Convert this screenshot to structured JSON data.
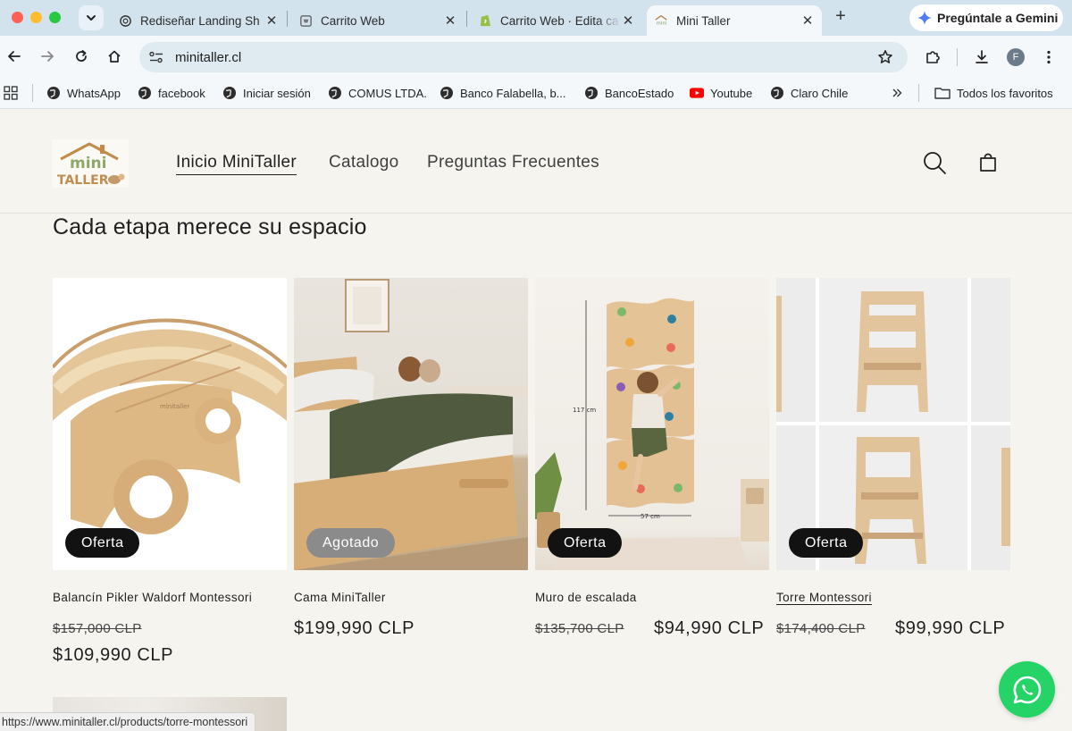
{
  "browser": {
    "tabs": [
      {
        "title": "Rediseñar Landing Sh",
        "favicon": "openai-icon"
      },
      {
        "title": "Carrito Web",
        "favicon": "cart-page-icon"
      },
      {
        "title": "Carrito Web · Edita ca",
        "favicon": "shopify-icon"
      },
      {
        "title": "Mini Taller",
        "favicon": "minitaller-icon"
      }
    ],
    "gemini_label": "Pregúntale a Gemini",
    "url": "minitaller.cl",
    "profile_initial": "F",
    "bookmarks": [
      "WhatsApp",
      "facebook",
      "Iniciar sesión",
      "COMUS LTDA.",
      "Banco Falabella, b...",
      "BancoEstado",
      "Youtube",
      "Claro Chile"
    ],
    "all_bookmarks": "Todos los favoritos",
    "status_url": "https://www.minitaller.cl/products/torre-montessori"
  },
  "site": {
    "logo_text_top": "mini",
    "logo_text_bottom": "TALLER",
    "nav": [
      "Inicio MiniTaller",
      "Catalogo",
      "Preguntas Frecuentes"
    ],
    "section_title": "Cada etapa merece su espacio",
    "products": [
      {
        "name": "Balancín Pikler Waldorf Montessori",
        "badge": "Oferta",
        "price_old": "$157,000 CLP",
        "price_new": "$109,990 CLP"
      },
      {
        "name": "Cama MiniTaller",
        "badge": "Agotado",
        "price_old": "",
        "price_new": "$199,990 CLP"
      },
      {
        "name": "Muro de escalada",
        "badge": "Oferta",
        "price_old": "$135,700 CLP",
        "price_new": "$94,990 CLP",
        "dim_height": "117 cm",
        "dim_width": "57 cm"
      },
      {
        "name": "Torre Montessori",
        "badge": "Oferta",
        "price_old": "$174,400 CLP",
        "price_new": "$99,990 CLP"
      }
    ]
  },
  "colors": {
    "badge_dark": "#121212",
    "badge_sold": "#8b8b8b",
    "whatsapp": "#25d366",
    "page_bg": "#f5f4ef"
  }
}
